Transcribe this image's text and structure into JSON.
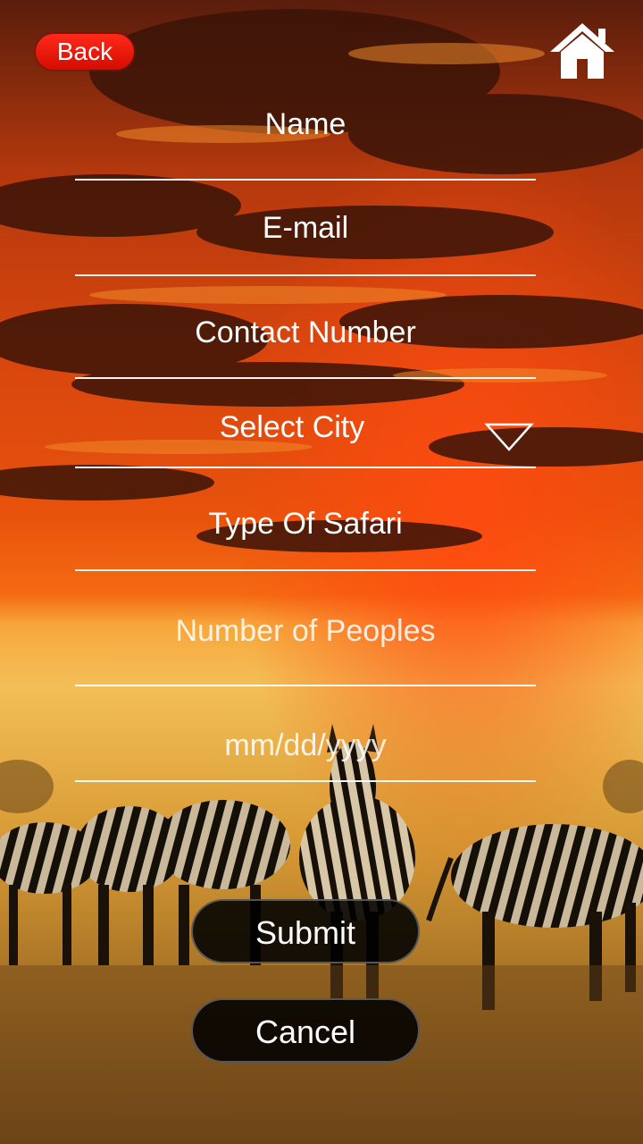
{
  "header": {
    "back_label": "Back",
    "home_icon": "home-icon"
  },
  "form": {
    "name_placeholder": "Name",
    "email_placeholder": "E-mail",
    "contact_placeholder": "Contact Number",
    "city_placeholder": "Select City",
    "safari_placeholder": "Type Of Safari",
    "people_placeholder": "Number of Peoples",
    "date_placeholder": "mm/dd/yyyy",
    "dropdown_icon": "chevron-down-icon"
  },
  "actions": {
    "submit_label": "Submit",
    "cancel_label": "Cancel"
  },
  "colors": {
    "back_button": "#e81708",
    "field_line": "#ffffff",
    "button_bg": "#000000"
  }
}
